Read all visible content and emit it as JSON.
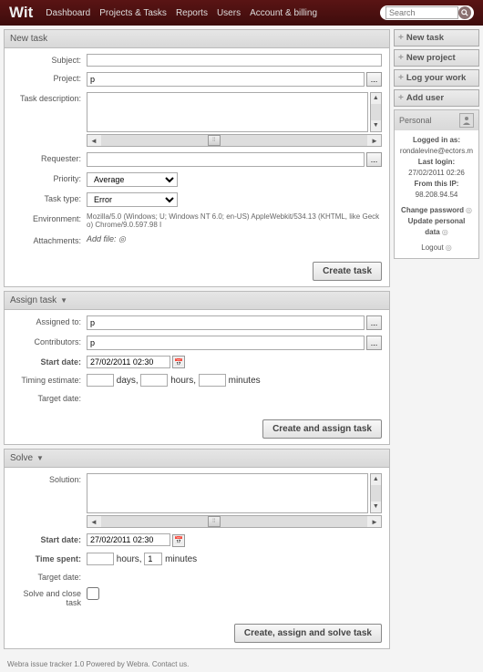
{
  "brand": "Wit",
  "nav": {
    "dashboard": "Dashboard",
    "projects": "Projects & Tasks",
    "reports": "Reports",
    "users": "Users",
    "account": "Account & billing"
  },
  "search": {
    "placeholder": "Search"
  },
  "sections": {
    "new_task": {
      "title": "New task"
    },
    "assign": {
      "title": "Assign task"
    },
    "solve": {
      "title": "Solve"
    }
  },
  "labels": {
    "subject": "Subject:",
    "project": "Project:",
    "task_desc": "Task description:",
    "requester": "Requester:",
    "priority": "Priority:",
    "task_type": "Task type:",
    "environment": "Environment:",
    "attachments": "Attachments:",
    "assigned_to": "Assigned to:",
    "contributors": "Contributors:",
    "start_date": "Start date:",
    "timing_estimate": "Timing estimate:",
    "target_date": "Target date:",
    "solution": "Solution:",
    "time_spent": "Time spent:",
    "solve_close": "Solve and close task",
    "add_file": "Add file:",
    "days": "days,",
    "hours": "hours,",
    "minutes": "minutes"
  },
  "values": {
    "project": "p",
    "priority": "Average",
    "task_type": "Error",
    "environment": "Mozilla/5.0 (Windows; U; Windows NT 6.0; en-US) AppleWebkit/534.13 (KHTML, like Gecko) Chrome/9.0.597.98 I",
    "assigned_to": "p",
    "contributors": "p",
    "start_date_1": "27/02/2011 02:30",
    "start_date_2": "27/02/2011 02:30",
    "time_spent_min": "1"
  },
  "buttons": {
    "create": "Create task",
    "create_assign": "Create and assign task",
    "create_solve": "Create, assign and solve task"
  },
  "sidebar": {
    "new_task": "New task",
    "new_project": "New project",
    "log_work": "Log your work",
    "add_user": "Add user",
    "personal_title": "Personal",
    "logged_in_lbl": "Logged in as:",
    "logged_in_val": "rondalevine@ectors.m",
    "last_login_lbl": "Last login:",
    "last_login_val": "27/02/2011 02:26",
    "from_ip_lbl": "From this IP:",
    "from_ip_val": "98.208.94.54",
    "change_pw": "Change password",
    "update_data": "Update personal data",
    "logout": "Logout"
  },
  "footer": "Webra issue tracker 1.0 Powered by Webra. Contact us."
}
